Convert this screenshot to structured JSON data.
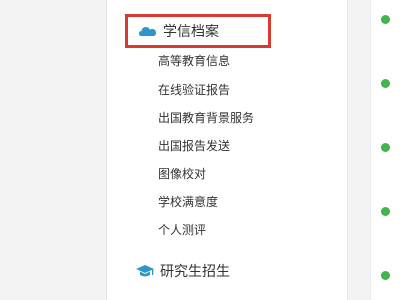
{
  "sidebar": {
    "active_section": {
      "title": "学信档案",
      "icon": "cloud-icon"
    },
    "items": [
      {
        "label": "高等教育信息"
      },
      {
        "label": "在线验证报告"
      },
      {
        "label": "出国教育背景服务"
      },
      {
        "label": "出国报告发送"
      },
      {
        "label": "图像校对"
      },
      {
        "label": "学校满意度"
      },
      {
        "label": "个人测评"
      }
    ],
    "next_section": {
      "title": "研究生招生",
      "icon": "graduation-cap-icon"
    }
  },
  "colors": {
    "accent": "#2e97c9",
    "highlight_border": "#d93b33",
    "bullet": "#42b34a",
    "text": "#333333"
  }
}
